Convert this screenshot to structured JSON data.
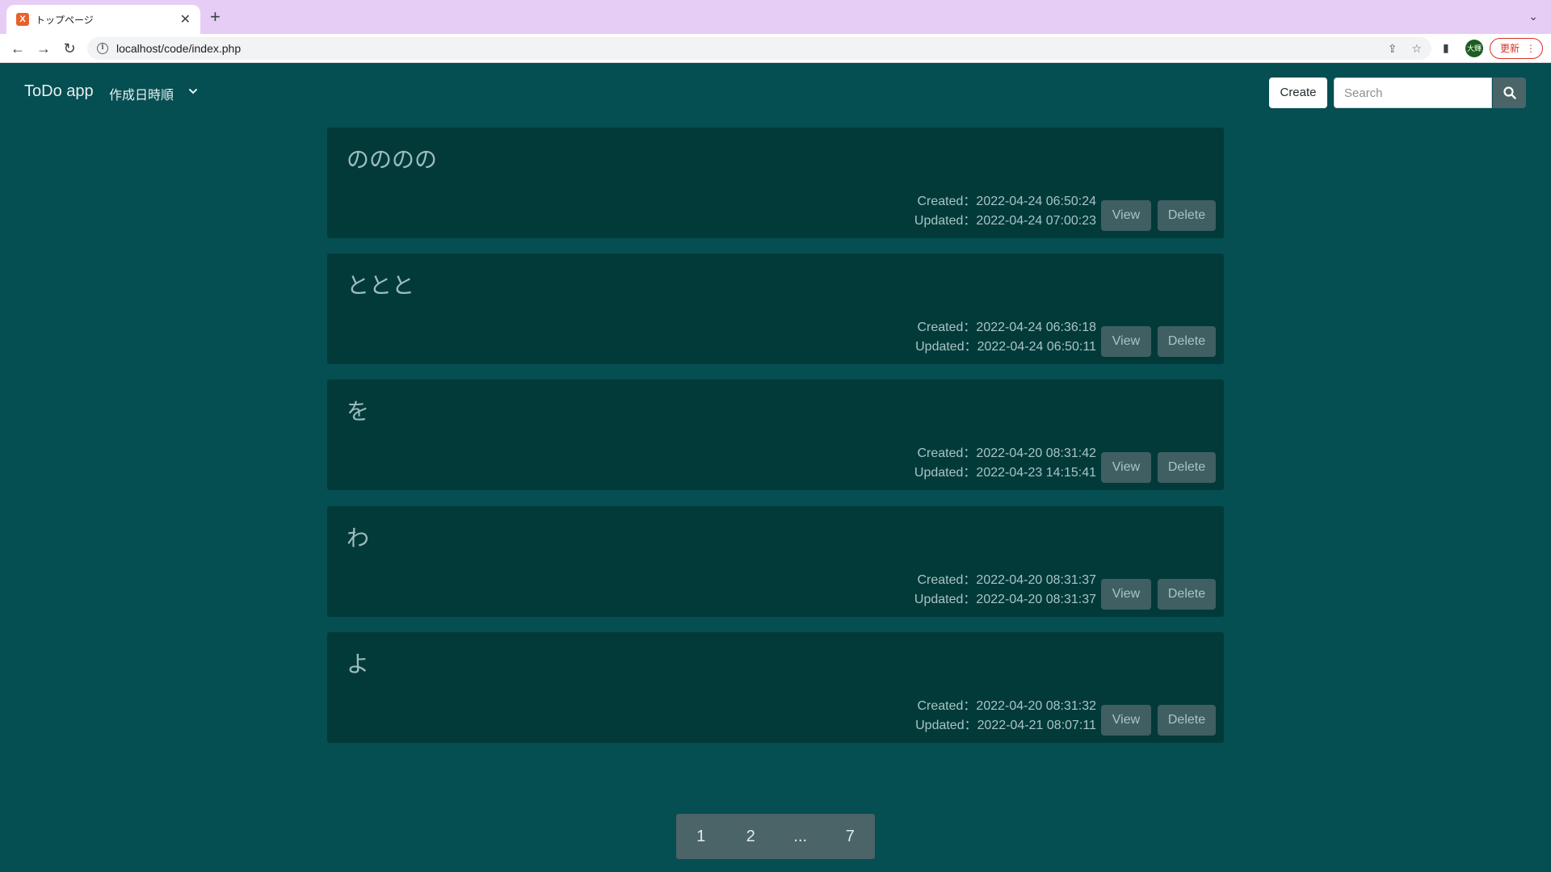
{
  "browser": {
    "tab_title": "トップページ",
    "url": "localhost/code/index.php",
    "avatar_text": "大輝",
    "update_label": "更新"
  },
  "navbar": {
    "brand": "ToDo app",
    "sort_label": "作成日時順",
    "create_label": "Create",
    "search_placeholder": "Search"
  },
  "todos": [
    {
      "title": "のののの",
      "created": "Created：2022-04-24 06:50:24",
      "updated": "Updated：2022-04-24 07:00:23",
      "view_label": "View",
      "delete_label": "Delete"
    },
    {
      "title": "ととと",
      "created": "Created：2022-04-24 06:36:18",
      "updated": "Updated：2022-04-24 06:50:11",
      "view_label": "View",
      "delete_label": "Delete"
    },
    {
      "title": "を",
      "created": "Created：2022-04-20 08:31:42",
      "updated": "Updated：2022-04-23 14:15:41",
      "view_label": "View",
      "delete_label": "Delete"
    },
    {
      "title": "わ",
      "created": "Created：2022-04-20 08:31:37",
      "updated": "Updated：2022-04-20 08:31:37",
      "view_label": "View",
      "delete_label": "Delete"
    },
    {
      "title": "よ",
      "created": "Created：2022-04-20 08:31:32",
      "updated": "Updated：2022-04-21 08:07:11",
      "view_label": "View",
      "delete_label": "Delete"
    }
  ],
  "pagination": [
    "1",
    "2",
    "...",
    "7"
  ],
  "colors": {
    "background": "#054e52",
    "card": "#023a3a",
    "button": "#3f5f63",
    "tabbar": "#e6cdf5"
  }
}
